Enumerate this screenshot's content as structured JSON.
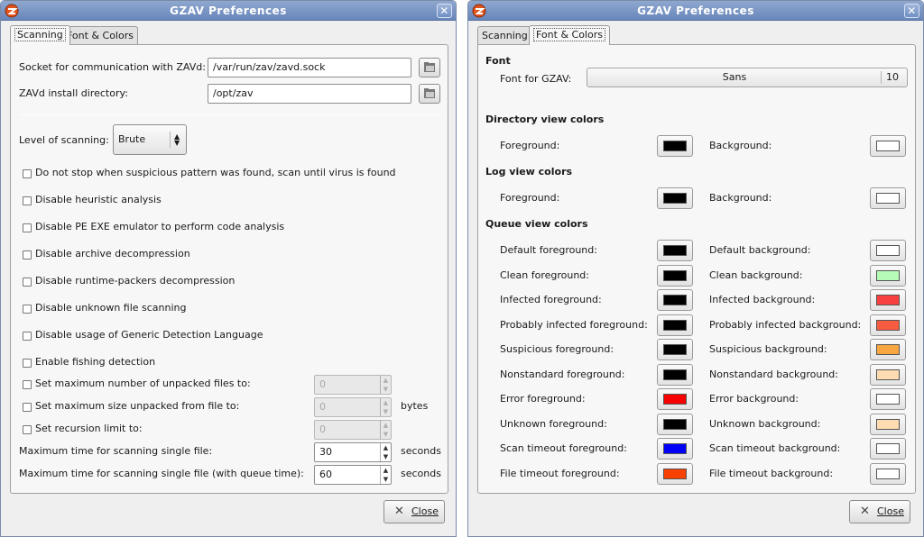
{
  "window_title": "GZAV Preferences",
  "tabs": {
    "scanning": "Scanning",
    "font_colors": "Font & Colors"
  },
  "scanning": {
    "socket_label": "Socket for communication with ZAVd:",
    "socket_value": "/var/run/zav/zavd.sock",
    "install_label": "ZAVd install directory:",
    "install_value": "/opt/zav",
    "level_label": "Level of scanning:",
    "level_value": "Brute",
    "options": [
      "Do not stop when suspicious pattern was found, scan until virus is found",
      "Disable heuristic analysis",
      "Disable PE EXE emulator to perform code analysis",
      "Disable archive decompression",
      "Disable runtime-packers decompression",
      "Disable unknown file scanning",
      "Disable usage of Generic Detection Language",
      "Enable fishing detection"
    ],
    "max_files_label": "Set maximum number of unpacked files to:",
    "max_files_value": "0",
    "max_size_label": "Set maximum size unpacked from file to:",
    "max_size_value": "0",
    "max_size_unit": "bytes",
    "recursion_label": "Set recursion limit to:",
    "recursion_value": "0",
    "max_time_label": "Maximum time for scanning single file:",
    "max_time_value": "30",
    "max_time_unit": "seconds",
    "max_time_queue_label": "Maximum time for scanning single file (with queue time):",
    "max_time_queue_value": "60",
    "max_time_queue_unit": "seconds"
  },
  "font_colors": {
    "font_heading": "Font",
    "font_label": "Font for GZAV:",
    "font_name": "Sans",
    "font_size": "10",
    "dir_heading": "Directory view colors",
    "log_heading": "Log view colors",
    "queue_heading": "Queue view colors",
    "dir_colors": [
      {
        "fg_label": "Foreground:",
        "fg": "#000000",
        "bg_label": "Background:",
        "bg": "#ffffff"
      }
    ],
    "log_colors": [
      {
        "fg_label": "Foreground:",
        "fg": "#000000",
        "bg_label": "Background:",
        "bg": "#ffffff"
      }
    ],
    "queue_colors": [
      {
        "fg_label": "Default foreground:",
        "fg": "#000000",
        "bg_label": "Default background:",
        "bg": "#ffffff"
      },
      {
        "fg_label": "Clean foreground:",
        "fg": "#000000",
        "bg_label": "Clean background:",
        "bg": "#b6fcb6"
      },
      {
        "fg_label": "Infected foreground:",
        "fg": "#000000",
        "bg_label": "Infected background:",
        "bg": "#f84040"
      },
      {
        "fg_label": "Probably infected foreground:",
        "fg": "#000000",
        "bg_label": "Probably infected background:",
        "bg": "#f85c40"
      },
      {
        "fg_label": "Suspicious foreground:",
        "fg": "#000000",
        "bg_label": "Suspicious background:",
        "bg": "#f8a640"
      },
      {
        "fg_label": "Nonstandard foreground:",
        "fg": "#000000",
        "bg_label": "Nonstandard background:",
        "bg": "#fcdcb0"
      },
      {
        "fg_label": "Error foreground:",
        "fg": "#f80000",
        "bg_label": "Error background:",
        "bg": "#ffffff"
      },
      {
        "fg_label": "Unknown foreground:",
        "fg": "#000000",
        "bg_label": "Unknown background:",
        "bg": "#fcdcb0"
      },
      {
        "fg_label": "Scan timeout foreground:",
        "fg": "#0000f8",
        "bg_label": "Scan timeout background:",
        "bg": "#ffffff"
      },
      {
        "fg_label": "File timeout foreground:",
        "fg": "#f84000",
        "bg_label": "File timeout background:",
        "bg": "#ffffff"
      }
    ]
  },
  "close_label": "Close"
}
